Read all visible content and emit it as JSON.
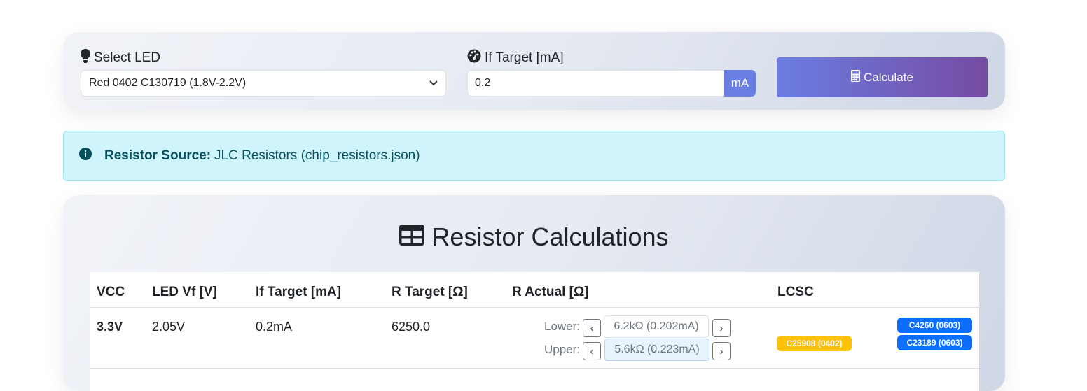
{
  "controls": {
    "led_label": "Select LED",
    "led_value": "Red 0402 C130719 (1.8V-2.2V)",
    "if_label": "If Target [mA]",
    "if_value": "0.2",
    "unit": "mA",
    "calculate_label": "Calculate"
  },
  "alert": {
    "heading": "Resistor Source:",
    "text": "JLC Resistors (chip_resistors.json)"
  },
  "results": {
    "title": "Resistor Calculations",
    "headers": [
      "VCC",
      "LED Vf [V]",
      "If Target [mA]",
      "R Target [Ω]",
      "R Actual [Ω]",
      "LCSC"
    ],
    "rows": [
      {
        "vcc": "3.3V",
        "vf": "2.05V",
        "if_target": "0.2mA",
        "r_target": "6250.0",
        "lower_label": "Lower:",
        "lower_value": "6.2kΩ (0.202mA)",
        "upper_label": "Upper:",
        "upper_value": "5.6kΩ (0.223mA)",
        "lcsc_badges": [
          "C25908 (0402)",
          "C4260 (0603)",
          "C23189 (0603)"
        ]
      }
    ]
  },
  "colors": {
    "accent": "#6b7fe3",
    "button_gradient_end": "#764ba2",
    "info_bg": "#cff4fc",
    "badge_yellow": "#ffc107",
    "badge_blue": "#0d6efd"
  }
}
